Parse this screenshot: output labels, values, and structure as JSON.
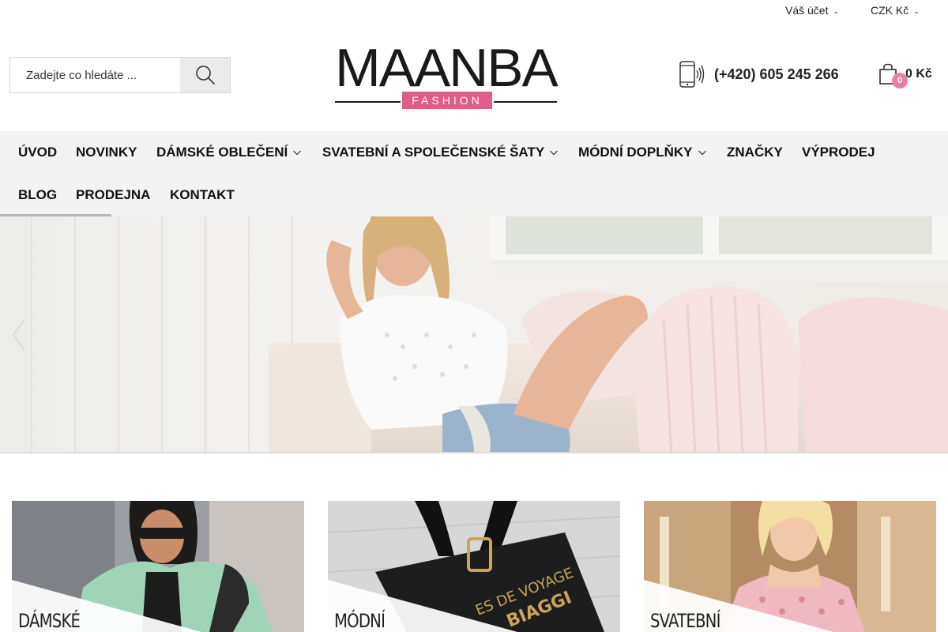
{
  "topbar": {
    "account_label": "Váš účet",
    "currency_label": "CZK Kč"
  },
  "search": {
    "placeholder": "Zadejte co hledáte ..."
  },
  "logo": {
    "main": "MAANBA",
    "sub": "FASHION"
  },
  "contact": {
    "phone": "(+420) 605 245 266"
  },
  "cart": {
    "count": "0",
    "total": "0 Kč"
  },
  "nav": {
    "items": [
      {
        "label": "ÚVOD"
      },
      {
        "label": "NOVINKY"
      },
      {
        "label": "DÁMSKÉ OBLEČENÍ"
      },
      {
        "label": "SVATEBNÍ A SPOLEČENSKÉ ŠATY"
      },
      {
        "label": "MÓDNÍ DOPLŇKY"
      },
      {
        "label": "ZNAČKY"
      },
      {
        "label": "VÝPRODEJ"
      },
      {
        "label": "BLOG"
      },
      {
        "label": "PRODEJNA"
      },
      {
        "label": "KONTAKT"
      }
    ]
  },
  "categories": [
    {
      "label": "DÁMSKÉ"
    },
    {
      "label": "MÓDNÍ"
    },
    {
      "label": "SVATEBNÍ"
    }
  ],
  "colors": {
    "accent": "#e25d86",
    "nav_bg": "#f3f3f3",
    "badge": "#e8809e"
  }
}
